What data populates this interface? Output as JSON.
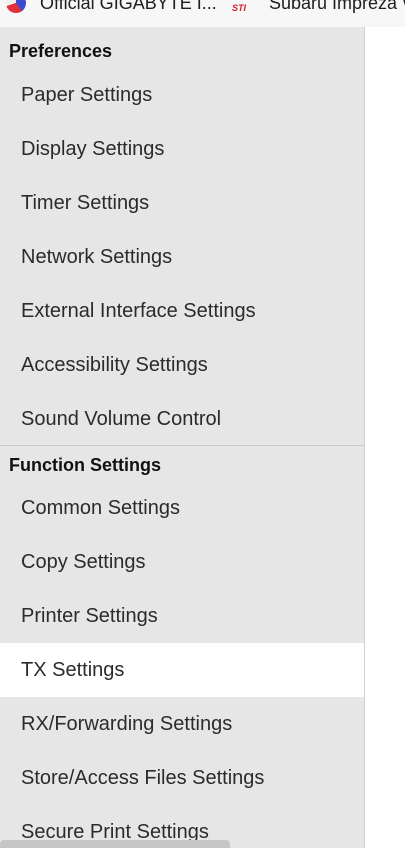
{
  "bookmarks": [
    {
      "label": "Official GIGABYTE I...",
      "icon": "gigabyte-icon"
    },
    {
      "label": "Subaru Impreza W",
      "icon": "subaru-sti-icon",
      "icon_text": "STI"
    }
  ],
  "sidebar": {
    "sections": [
      {
        "title": "Preferences",
        "items": [
          {
            "label": "Paper Settings"
          },
          {
            "label": "Display Settings"
          },
          {
            "label": "Timer Settings"
          },
          {
            "label": "Network Settings"
          },
          {
            "label": "External Interface Settings"
          },
          {
            "label": "Accessibility Settings"
          },
          {
            "label": "Sound Volume Control"
          }
        ]
      },
      {
        "title": "Function Settings",
        "items": [
          {
            "label": "Common Settings"
          },
          {
            "label": "Copy Settings"
          },
          {
            "label": "Printer Settings"
          },
          {
            "label": "TX Settings",
            "selected": true
          },
          {
            "label": "RX/Forwarding Settings"
          },
          {
            "label": "Store/Access Files Settings"
          },
          {
            "label": "Secure Print Settings"
          }
        ]
      }
    ]
  },
  "colors": {
    "sidebar_bg": "#e6e6e6",
    "selected_bg": "#ffffff",
    "text": "#2b2b2b",
    "sti_red": "#d21f2b"
  }
}
